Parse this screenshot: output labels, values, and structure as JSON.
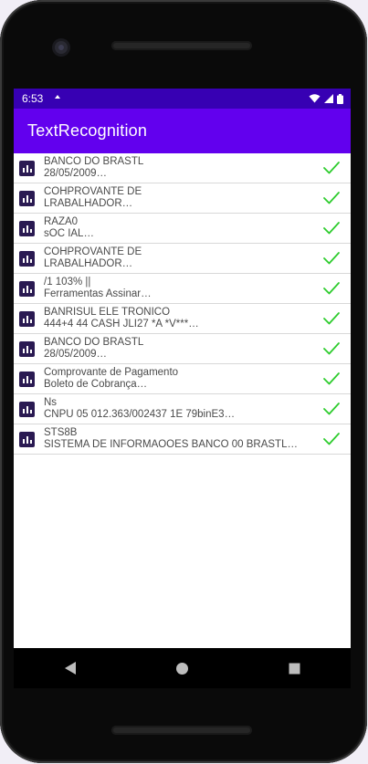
{
  "status": {
    "time": "6:53"
  },
  "appbar": {
    "title": "TextRecognition"
  },
  "colors": {
    "statusbar": "#3700b3",
    "appbar": "#6200ee",
    "check": "#2ecc2e",
    "icon": "#2a1a52"
  },
  "list": {
    "items": [
      {
        "title": "BANCO DO BRASTL",
        "subtitle": "28/05/2009…"
      },
      {
        "title": "COHPROVANTE DE",
        "subtitle": "LRABALHADOR…"
      },
      {
        "title": "RAZA0",
        "subtitle": "sOC IAL…"
      },
      {
        "title": "COHPROVANTE DE",
        "subtitle": "LRABALHADOR…"
      },
      {
        "title": "/1 103% ||",
        "subtitle": "Ferramentas Assinar…"
      },
      {
        "title": "BANRISUL ELE TRONICO",
        "subtitle": "444+4 44 CASH JLI27 *A *V***…"
      },
      {
        "title": "BANCO DO BRASTL",
        "subtitle": "28/05/2009…"
      },
      {
        "title": "Comprovante de Pagamento",
        "subtitle": "Boleto de Cobrança…"
      },
      {
        "title": "Ns",
        "subtitle": "CNPU 05 012.363/002437 1E 79binE3…"
      },
      {
        "title": "STS8B",
        "subtitle": "SISTEMA DE INFORMAOOES BANCO 00 BRASTL…"
      }
    ]
  },
  "icons": {
    "row": "bar-chart-icon",
    "status": "check-icon",
    "nav": [
      "back-icon",
      "home-icon",
      "recents-icon"
    ]
  }
}
